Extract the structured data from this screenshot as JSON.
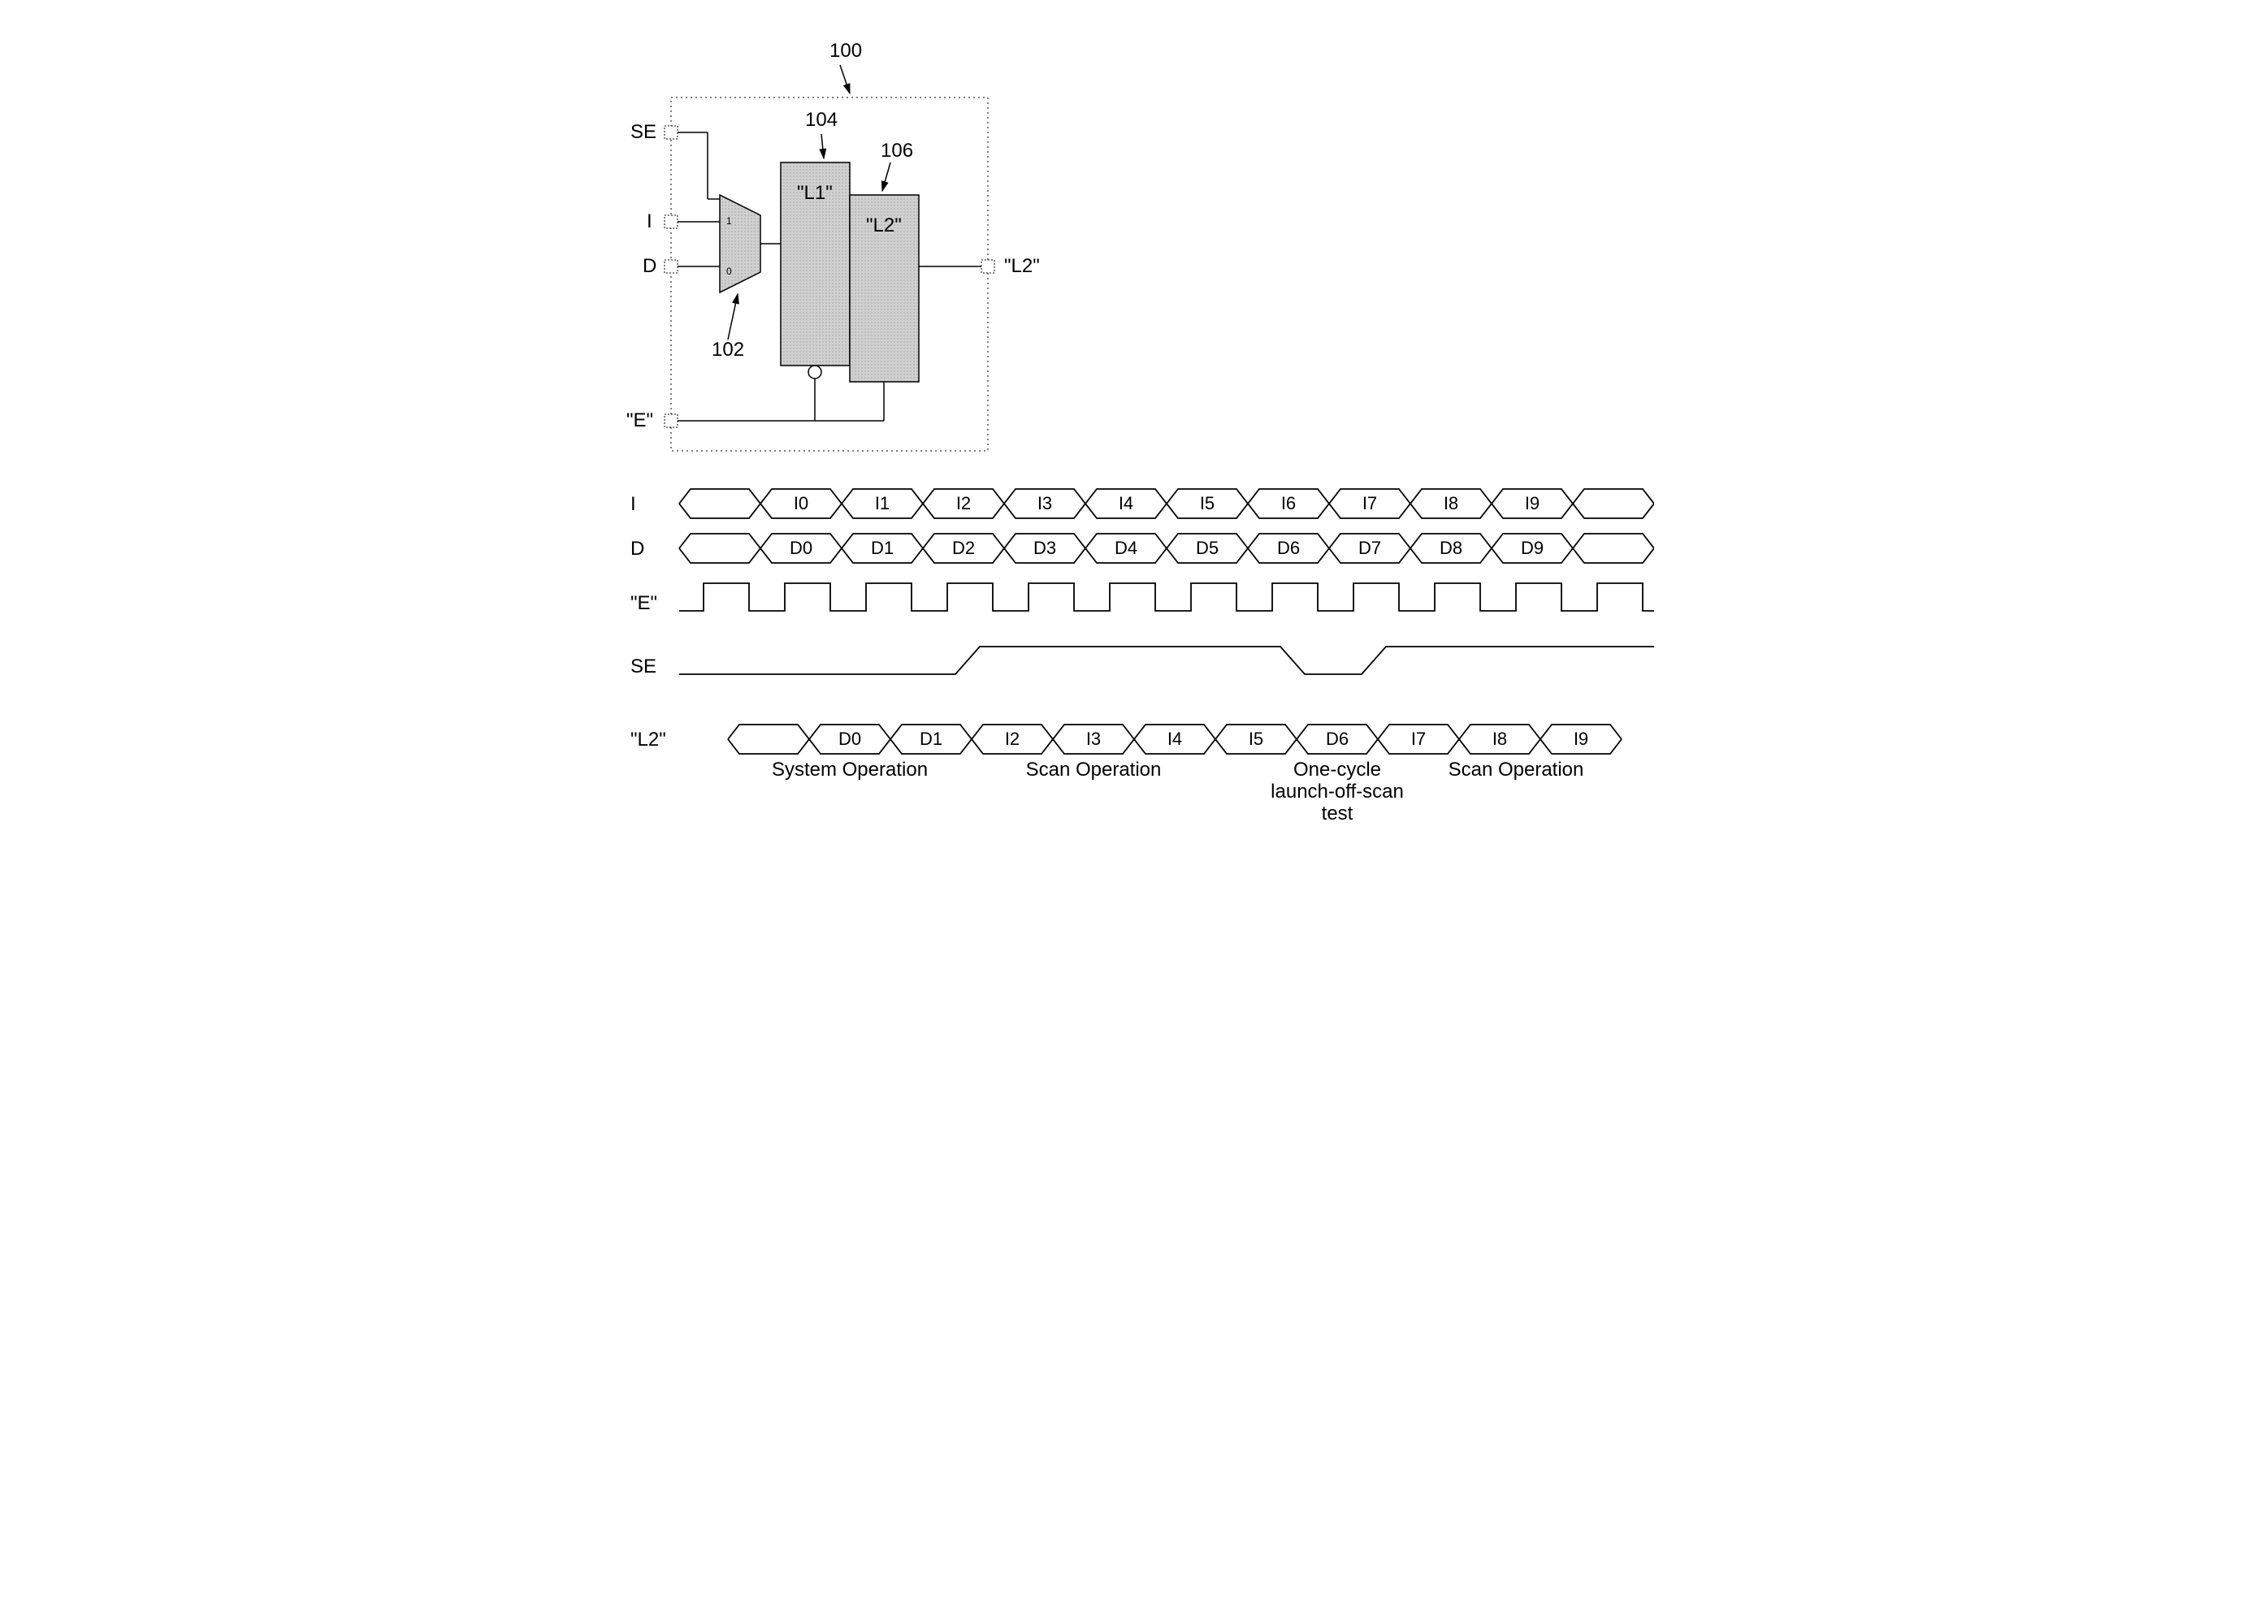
{
  "circuit": {
    "ref_main": "100",
    "ref_mux": "102",
    "ref_l1": "104",
    "ref_l2": "106",
    "ports": {
      "se": "SE",
      "i": "I",
      "d": "D",
      "e": "\"E\"",
      "out": "\"L2\""
    },
    "blocks": {
      "l1": "\"L1\"",
      "l2": "\"L2\""
    },
    "mux": {
      "in1": "1",
      "in0": "0"
    }
  },
  "timing": {
    "rows": {
      "i": {
        "label": "I",
        "cells": [
          "I0",
          "I1",
          "I2",
          "I3",
          "I4",
          "I5",
          "I6",
          "I7",
          "I8",
          "I9"
        ]
      },
      "d": {
        "label": "D",
        "cells": [
          "D0",
          "D1",
          "D2",
          "D3",
          "D4",
          "D5",
          "D6",
          "D7",
          "D8",
          "D9"
        ]
      },
      "e": {
        "label": "\"E\""
      },
      "se": {
        "label": "SE"
      },
      "l2": {
        "label": "\"L2\"",
        "cells": [
          "D0",
          "D1",
          "I2",
          "I3",
          "I4",
          "I5",
          "D6",
          "I7",
          "I8",
          "I9"
        ]
      }
    },
    "annotations": {
      "sys_op": "System Operation",
      "scan_op1": "Scan Operation",
      "one_cycle_l1": "One-cycle",
      "one_cycle_l2": "launch-off-scan",
      "one_cycle_l3": "test",
      "scan_op2": "Scan Operation"
    }
  }
}
